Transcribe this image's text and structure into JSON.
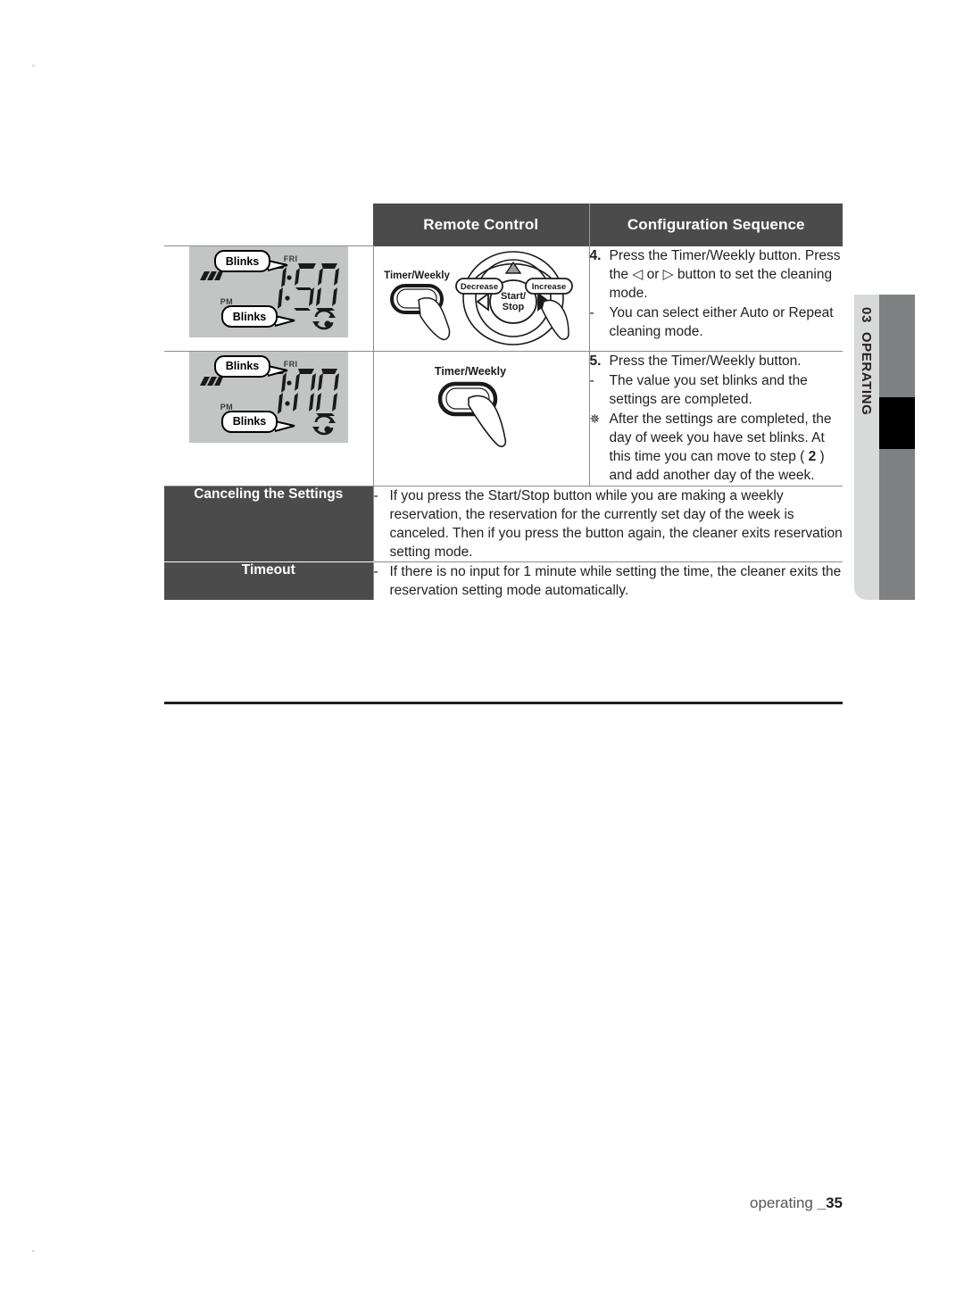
{
  "page": {
    "footer_label": "operating",
    "footer_page": "_35"
  },
  "side_tab": {
    "number": "03",
    "label": "OPERATING",
    "light_color": "#d8d9d9",
    "gray_color": "#7f8081",
    "block_color": "#000000"
  },
  "table": {
    "headers": {
      "blank": "",
      "remote_control": "Remote Control",
      "configuration_sequence": "Configuration Sequence"
    },
    "rows": [
      {
        "lcd": {
          "battery_icon": "battery-icon",
          "pm_label": "PM",
          "day_label": "FRI",
          "time": "7:50",
          "repeat_icon": "repeat-icon",
          "bubble_top": "Blinks",
          "bubble_bottom": "Blinks"
        },
        "remote": {
          "timer_weekly_label": "Timer/Weekly",
          "decrease_label": "Decrease",
          "increase_label": "Increase",
          "start_stop_line1": "Start/",
          "start_stop_line2": "Stop",
          "has_dpad": true
        },
        "steps": [
          {
            "marker": "4.",
            "marker_type": "number",
            "text": "Press the Timer/Weekly button. Press the ◁ or ▷ button to set the cleaning mode."
          },
          {
            "marker": "-",
            "marker_type": "dash",
            "text": "You can select either Auto or Repeat cleaning mode."
          }
        ]
      },
      {
        "lcd": {
          "battery_icon": "battery-icon",
          "pm_label": "PM",
          "day_label": "FRI",
          "time": "7:00",
          "repeat_icon": "repeat-icon",
          "bubble_top": "Blinks",
          "bubble_bottom": "Blinks"
        },
        "remote": {
          "timer_weekly_label": "Timer/Weekly",
          "has_dpad": false
        },
        "steps": [
          {
            "marker": "5.",
            "marker_type": "number",
            "text": "Press the Timer/Weekly button."
          },
          {
            "marker": "-",
            "marker_type": "dash",
            "text": "The value you set blinks and the settings are completed."
          },
          {
            "marker": "✵",
            "marker_type": "star",
            "text_before": "After the settings are completed, the day of week you have set blinks. At this time you can move to step ( ",
            "emphasis": "2",
            "text_after": " ) and add another day of the week."
          }
        ]
      }
    ],
    "notes": [
      {
        "label": "Canceling the Settings",
        "marker": "-",
        "text": "If you press the Start/Stop button while you are making a weekly reservation, the reservation for the currently set day of the week is canceled. Then if you press the button again, the cleaner exits reservation setting mode."
      },
      {
        "label": "Timeout",
        "marker": "-",
        "text": "If there is no input for 1 minute while setting the time, the cleaner exits the reservation setting mode automatically."
      }
    ]
  }
}
